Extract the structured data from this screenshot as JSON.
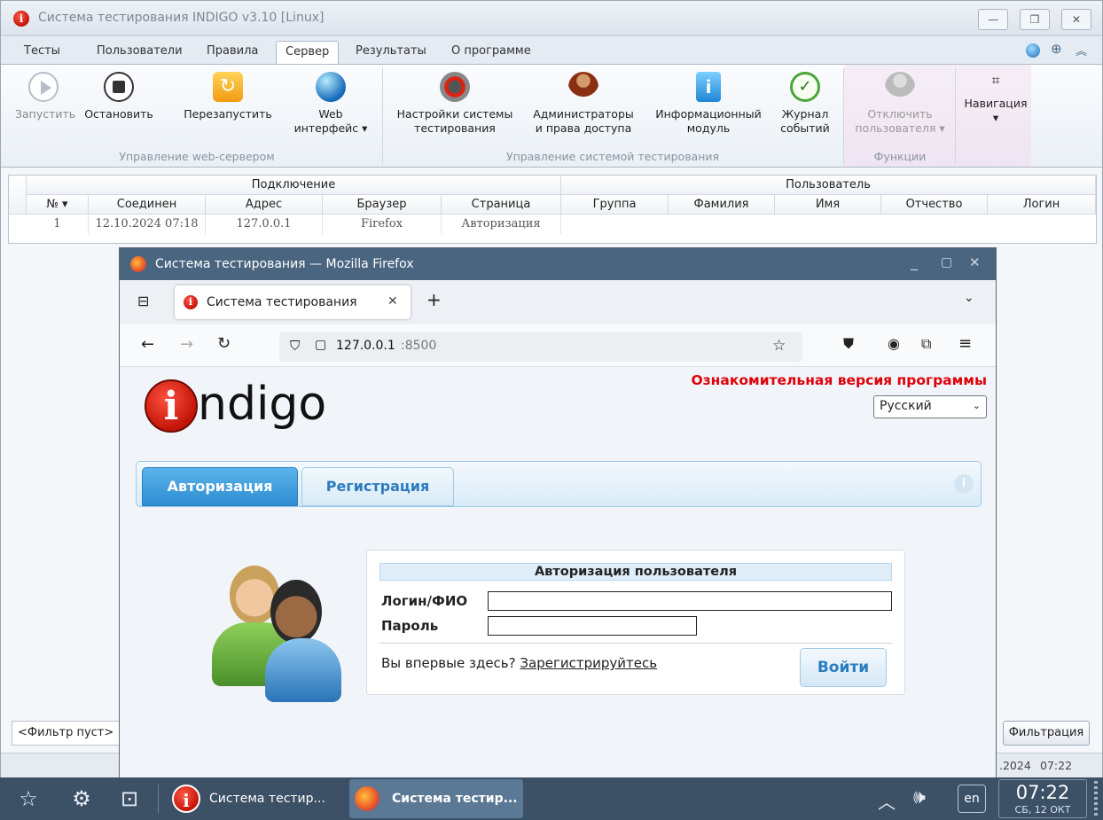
{
  "window": {
    "title": "Система тестирования INDIGO v3.10 [Linux]"
  },
  "menu": {
    "tabs": [
      "Тесты",
      "Пользователи",
      "Правила",
      "Сервер",
      "Результаты",
      "О программе"
    ],
    "active": "Сервер"
  },
  "ribbon": {
    "buttons": {
      "start": "Запустить",
      "stop": "Остановить",
      "restart": "Перезапустить",
      "web": "Web интерфейс",
      "settings": "Настройки системы тестирования",
      "admins": "Администраторы и права доступа",
      "info": "Информационный модуль",
      "journal": "Журнал событий",
      "disconnect": "Отключить пользователя",
      "navigation": "Навигация"
    },
    "groups": {
      "web": "Управление web-сервером",
      "system": "Управление системой тестирования",
      "functions": "Функции"
    }
  },
  "grid": {
    "group_headers": {
      "connection": "Подключение",
      "user": "Пользователь"
    },
    "columns": [
      "№",
      "Соединен",
      "Адрес",
      "Браузер",
      "Страница",
      "Группа",
      "Фамилия",
      "Имя",
      "Отчество",
      "Логин"
    ],
    "rows": [
      [
        "1",
        "12.10.2024 07:18",
        "127.0.0.1",
        "Firefox",
        "Авторизация",
        "",
        "",
        "",
        "",
        ""
      ]
    ]
  },
  "bottom": {
    "filter_status": "<Фильтр пуст>",
    "filter_button": "Фильтрация",
    "date_fragment": ".2024",
    "time": "07:22"
  },
  "firefox": {
    "title": "Система тестирования — Mozilla Firefox",
    "tab_title": "Система тестирования",
    "url_host": "127.0.0.1",
    "url_port": ":8500"
  },
  "page": {
    "logo_text": "ndigo",
    "trial_notice": "Ознакомительная версия программы",
    "language": "Русский",
    "tabs": {
      "login": "Авторизация",
      "register": "Регистрация"
    },
    "auth": {
      "heading": "Авторизация пользователя",
      "login_label": "Логин/ФИО",
      "password_label": "Пароль",
      "first_time": "Вы впервые здесь?",
      "register_link": "Зарегистрируйтесь",
      "submit": "Войти"
    }
  },
  "taskbar": {
    "app1": "Система тестир...",
    "app2": "Система тестир...",
    "lang": "en",
    "clock": "07:22",
    "date": "СБ, 12 ОКТ"
  }
}
